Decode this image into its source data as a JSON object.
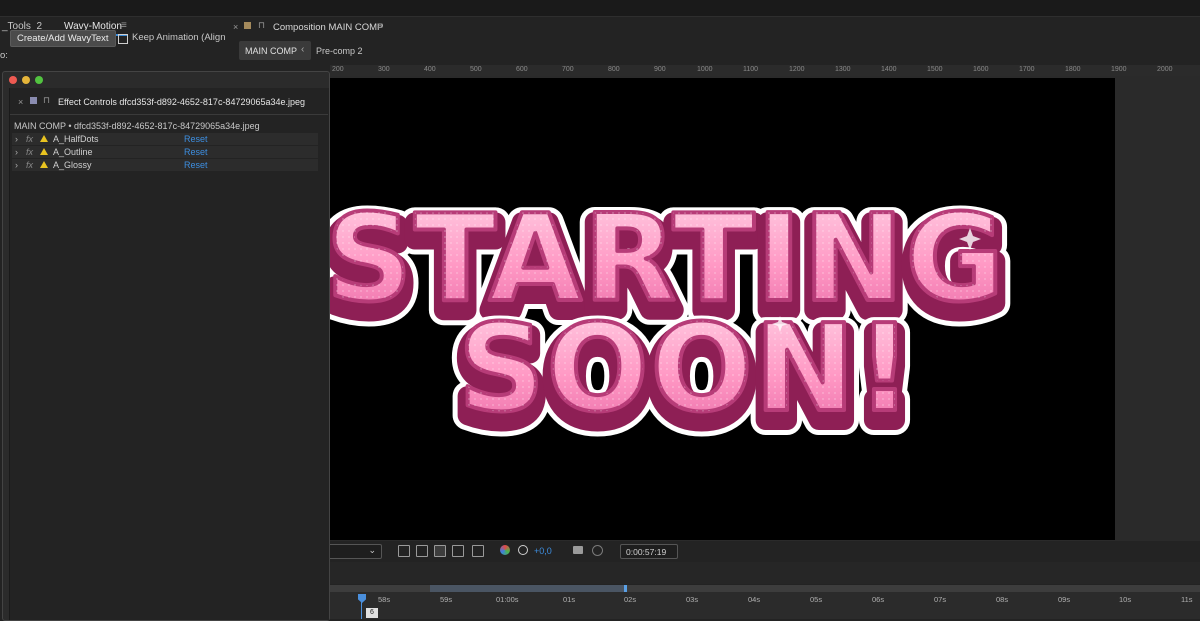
{
  "left_panel": {
    "tabs": [
      "_Tools_2",
      "Wavy-Motion"
    ],
    "partial_label": "o:",
    "create_button": "Create/Add WavyText",
    "keep_animation_label": "Keep Animation (Align"
  },
  "composition_panel": {
    "title": "Composition MAIN COMP",
    "tabs": [
      "MAIN COMP",
      "Pre-comp 2"
    ],
    "ruler_labels": [
      "200",
      "300",
      "400",
      "500",
      "600",
      "700",
      "800",
      "900",
      "1000",
      "1100",
      "1200",
      "1300",
      "1400",
      "1500",
      "1600",
      "1700",
      "1800",
      "1900",
      "2000"
    ],
    "viewer_text_line1": "STARTING",
    "viewer_text_line2": "SOON!",
    "toolbar": {
      "exposure_value": "+0,0",
      "timecode": "0:00:57:19"
    }
  },
  "effect_controls": {
    "title": "Effect Controls dfcd353f-d892-4652-817c-84729065a34e.jpeg",
    "subtitle": "MAIN COMP • dfcd353f-d892-4652-817c-84729065a34e.jpeg",
    "effects": [
      {
        "name": "A_HalfDots",
        "reset": "Reset"
      },
      {
        "name": "A_Outline",
        "reset": "Reset"
      },
      {
        "name": "A_Glossy",
        "reset": "Reset"
      }
    ]
  },
  "timeline": {
    "labels": [
      "58s",
      "59s",
      "01:00s",
      "01s",
      "02s",
      "03s",
      "04s",
      "05s",
      "06s",
      "07s",
      "08s",
      "09s",
      "10s",
      "11s"
    ],
    "playhead_value": "6"
  },
  "colors": {
    "accent_blue": "#3a8bd8",
    "text_pink": "#ff9cc8",
    "outline_magenta": "#8e1f55"
  }
}
